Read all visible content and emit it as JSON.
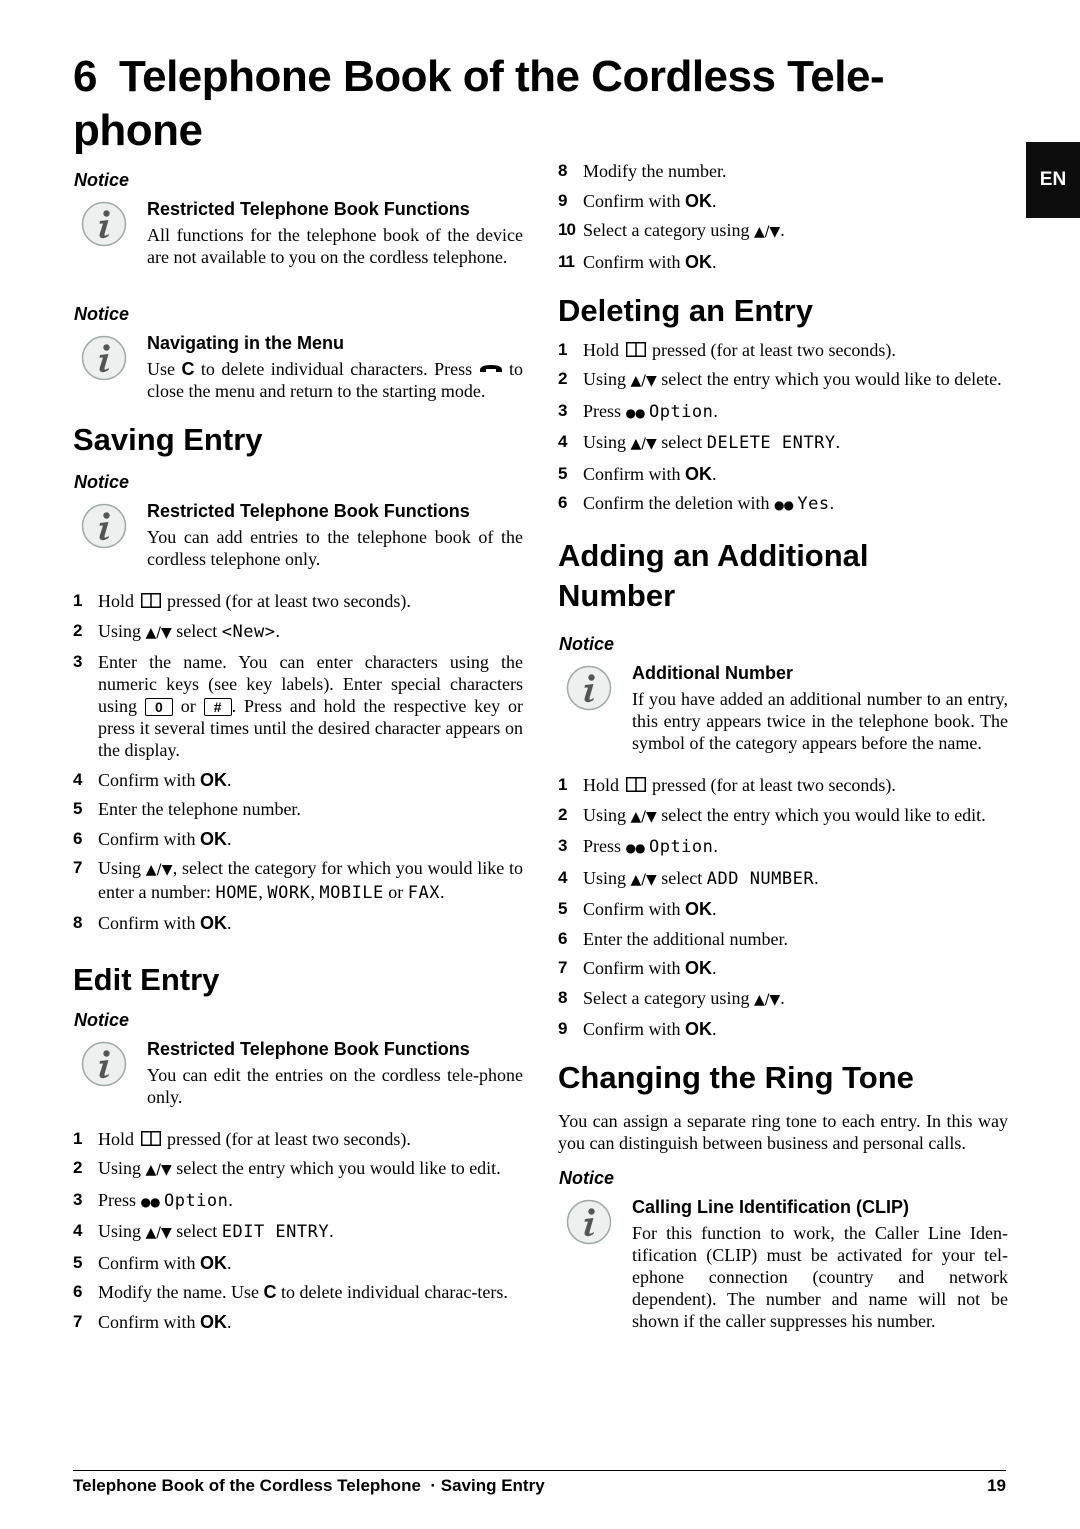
{
  "page": {
    "chapter_number": "6",
    "chapter_title": "Telephone Book of the Cordless Tele-phone",
    "chapter_title_line1": "Telephone Book of the Cordless Tele-",
    "chapter_title_line2": "phone",
    "language_tab": "EN"
  },
  "icons": {
    "info": "info-icon",
    "book": "phonebook-key-icon",
    "arrows": "▲/▼",
    "softkey": "●●",
    "hangup": "hang-up-key-icon"
  },
  "notice_label": "Notice",
  "left": {
    "notice1": {
      "label": "Notice",
      "title": "Restricted Telephone Book Functions",
      "text": "All functions for the telephone book of the device are not available to you on the cordless telephone."
    },
    "notice2": {
      "label": "Notice",
      "title": "Navigating in the Menu",
      "text_a": "Use ",
      "key_c": "C",
      "text_b": " to delete individual characters. Press ",
      "text_c": " to close the menu and return to the starting mode."
    },
    "saving": {
      "heading": "Saving Entry",
      "notice": {
        "label": "Notice",
        "title": "Restricted Telephone Book Functions",
        "text": "You can add entries to the telephone book of the cordless telephone only."
      },
      "steps": [
        {
          "n": "1",
          "a": "Hold ",
          "b": " pressed (for at least two seconds)."
        },
        {
          "n": "2",
          "a": "Using ",
          "b": " select ",
          "display": "<New>",
          "c": "."
        },
        {
          "n": "3",
          "a": "Enter the name. You can enter characters using the numeric keys (see key labels).  Enter special characters using ",
          "key1": "0",
          "or": " or ",
          "key2": "#",
          "c": ". Press and hold the respective key or press it several times until the desired character appears on the display."
        },
        {
          "n": "4",
          "a": "Confirm with ",
          "ok": "OK",
          "c": "."
        },
        {
          "n": "5",
          "a": "Enter the telephone number."
        },
        {
          "n": "6",
          "a": "Confirm with ",
          "ok": "OK",
          "c": "."
        },
        {
          "n": "7",
          "a": "Using ",
          "b": ", select the category for which you would like to enter a number: ",
          "d1": "HOME",
          "s1": ", ",
          "d2": "WORK",
          "s2": ", ",
          "d3": "MOBILE",
          "s3": " or ",
          "d4": "FAX",
          "c": "."
        },
        {
          "n": "8",
          "a": "Confirm with ",
          "ok": "OK",
          "c": "."
        }
      ]
    },
    "edit": {
      "heading": "Edit Entry",
      "notice": {
        "label": "Notice",
        "title": "Restricted Telephone Book Functions",
        "text": "You can edit the entries on the cordless tele-phone only."
      },
      "steps": [
        {
          "n": "1",
          "a": "Hold ",
          "b": " pressed (for at least two seconds)."
        },
        {
          "n": "2",
          "a": "Using ",
          "b": " select the entry which you would like to edit."
        },
        {
          "n": "3",
          "a": "Press ",
          "display": "Option",
          "c": "."
        },
        {
          "n": "4",
          "a": "Using ",
          "b": " select ",
          "display": "EDIT ENTRY",
          "c": "."
        },
        {
          "n": "5",
          "a": "Confirm with ",
          "ok": "OK",
          "c": "."
        },
        {
          "n": "6",
          "a": "Modify the name. Use ",
          "key": "C",
          "b": " to delete individual charac-ters."
        },
        {
          "n": "7",
          "a": "Confirm with ",
          "ok": "OK",
          "c": "."
        }
      ]
    }
  },
  "right": {
    "edit_continued": [
      {
        "n": "8",
        "a": "Modify the number."
      },
      {
        "n": "9",
        "a": "Confirm with ",
        "ok": "OK",
        "c": "."
      },
      {
        "n": "10",
        "a": "Select a category using ",
        "c": "."
      },
      {
        "n": "11",
        "a": "Confirm with ",
        "ok": "OK",
        "c": "."
      }
    ],
    "deleting": {
      "heading": "Deleting an Entry",
      "steps": [
        {
          "n": "1",
          "a": "Hold ",
          "b": " pressed (for at least two seconds)."
        },
        {
          "n": "2",
          "a": "Using ",
          "b": " select the entry which you would like to delete."
        },
        {
          "n": "3",
          "a": "Press ",
          "display": "Option",
          "c": "."
        },
        {
          "n": "4",
          "a": "Using ",
          "b": " select ",
          "display": "DELETE ENTRY",
          "c": "."
        },
        {
          "n": "5",
          "a": "Confirm with ",
          "ok": "OK",
          "c": "."
        },
        {
          "n": "6",
          "a": "Confirm the deletion with ",
          "display": "Yes",
          "c": "."
        }
      ]
    },
    "additional": {
      "heading_line1": "Adding an Additional",
      "heading_line2": "Number",
      "notice": {
        "label": "Notice",
        "title": "Additional Number",
        "text": "If you have added an additional number to an entry, this entry appears twice in the telephone book. The symbol of the category appears before the name."
      },
      "steps": [
        {
          "n": "1",
          "a": "Hold ",
          "b": " pressed (for at least two seconds)."
        },
        {
          "n": "2",
          "a": "Using ",
          "b": " select the entry which you would like to edit."
        },
        {
          "n": "3",
          "a": "Press ",
          "display": "Option",
          "c": "."
        },
        {
          "n": "4",
          "a": "Using ",
          "b": " select ",
          "display": "ADD NUMBER",
          "c": "."
        },
        {
          "n": "5",
          "a": "Confirm with ",
          "ok": "OK",
          "c": "."
        },
        {
          "n": "6",
          "a": "Enter the additional number."
        },
        {
          "n": "7",
          "a": "Confirm with ",
          "ok": "OK",
          "c": "."
        },
        {
          "n": "8",
          "a": "Select a category using ",
          "c": "."
        },
        {
          "n": "9",
          "a": "Confirm with ",
          "ok": "OK",
          "c": "."
        }
      ]
    },
    "ringtone": {
      "heading": "Changing the Ring Tone",
      "text": "You can assign a separate ring tone to each entry. In this way you can distinguish between business and personal calls.",
      "notice": {
        "label": "Notice",
        "title": "Calling Line Identification (CLIP)",
        "text": "For this function to work, the Caller Line Iden-tification (CLIP) must be activated for your tel-ephone connection (country and network dependent). The number and name will not be shown if the caller suppresses his number."
      }
    }
  },
  "footer": {
    "breadcrumb": "Telephone Book of the Cordless Telephone  · Saving Entry",
    "page_number": "19"
  }
}
